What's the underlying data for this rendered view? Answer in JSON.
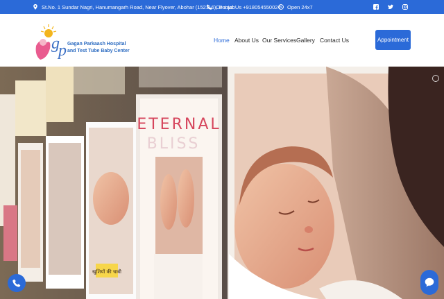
{
  "topbar": {
    "address": "St.No. 1 Sundar Nagri, Hanumangarh Road, Near Flyover, Abohar (152116), Punjab",
    "contact": "Contact Us +918054550024",
    "hours": "Open  24x7",
    "social": [
      "facebook-icon",
      "twitter-icon",
      "instagram-icon"
    ]
  },
  "logo": {
    "line1": "Gagan Parkaash Hospital",
    "line2": "and Test Tube Baby Center"
  },
  "nav": {
    "items": [
      {
        "label": "Home",
        "active": true
      },
      {
        "label": "About Us",
        "active": false
      },
      {
        "label": "Our Services",
        "active": false
      },
      {
        "label": "Gallery",
        "active": false
      },
      {
        "label": "Contact Us",
        "active": false
      }
    ],
    "appointment": "Appointment"
  },
  "hero": {
    "poster_title_line1": "ETERNAL",
    "poster_title_line2": "BLISS",
    "poster_hindi": "खुशियों की चाबी"
  },
  "colors": {
    "brand": "#2b6ad8",
    "logo_text": "#2a6ac0"
  }
}
